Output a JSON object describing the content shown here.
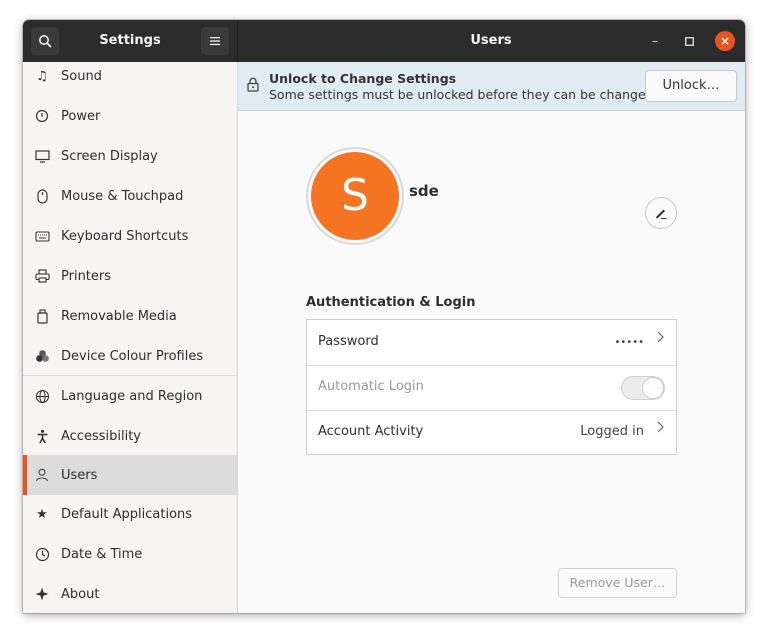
{
  "header": {
    "sidebar_title": "Settings",
    "main_title": "Users",
    "minimize_glyph": "–",
    "maximize_glyph": "□",
    "close_glyph": "×"
  },
  "sidebar": {
    "items": [
      {
        "label": "Sound",
        "icon": "music-note-icon"
      },
      {
        "label": "Power",
        "icon": "power-icon"
      },
      {
        "label": "Screen Display",
        "icon": "display-icon"
      },
      {
        "label": "Mouse & Touchpad",
        "icon": "mouse-icon"
      },
      {
        "label": "Keyboard Shortcuts",
        "icon": "keyboard-icon"
      },
      {
        "label": "Printers",
        "icon": "printer-icon"
      },
      {
        "label": "Removable Media",
        "icon": "removable-media-icon"
      },
      {
        "label": "Device Colour Profiles",
        "icon": "color-profiles-icon"
      },
      {
        "label": "Language and Region",
        "icon": "globe-icon"
      },
      {
        "label": "Accessibility",
        "icon": "accessibility-icon"
      },
      {
        "label": "Users",
        "icon": "users-icon",
        "selected": true
      },
      {
        "label": "Default Applications",
        "icon": "star-icon"
      },
      {
        "label": "Date & Time",
        "icon": "clock-icon"
      },
      {
        "label": "About",
        "icon": "sparkle-icon"
      }
    ]
  },
  "infobar": {
    "title": "Unlock to Change Settings",
    "subtitle": "Some settings must be unlocked before they can be changed.",
    "button_label": "Unlock…"
  },
  "user": {
    "avatar_letter": "S",
    "name": "sde",
    "avatar_color": "#f47421"
  },
  "auth": {
    "section_title": "Authentication & Login",
    "rows": [
      {
        "label": "Password",
        "value": "•••••"
      },
      {
        "label": "Automatic Login",
        "enabled": false
      },
      {
        "label": "Account Activity",
        "value": "Logged in"
      }
    ]
  },
  "remove_button_label": "Remove User…",
  "colors": {
    "accent": "#e95420",
    "headerbar": "#2c2c2c",
    "infobar": "#e1ecf2"
  }
}
